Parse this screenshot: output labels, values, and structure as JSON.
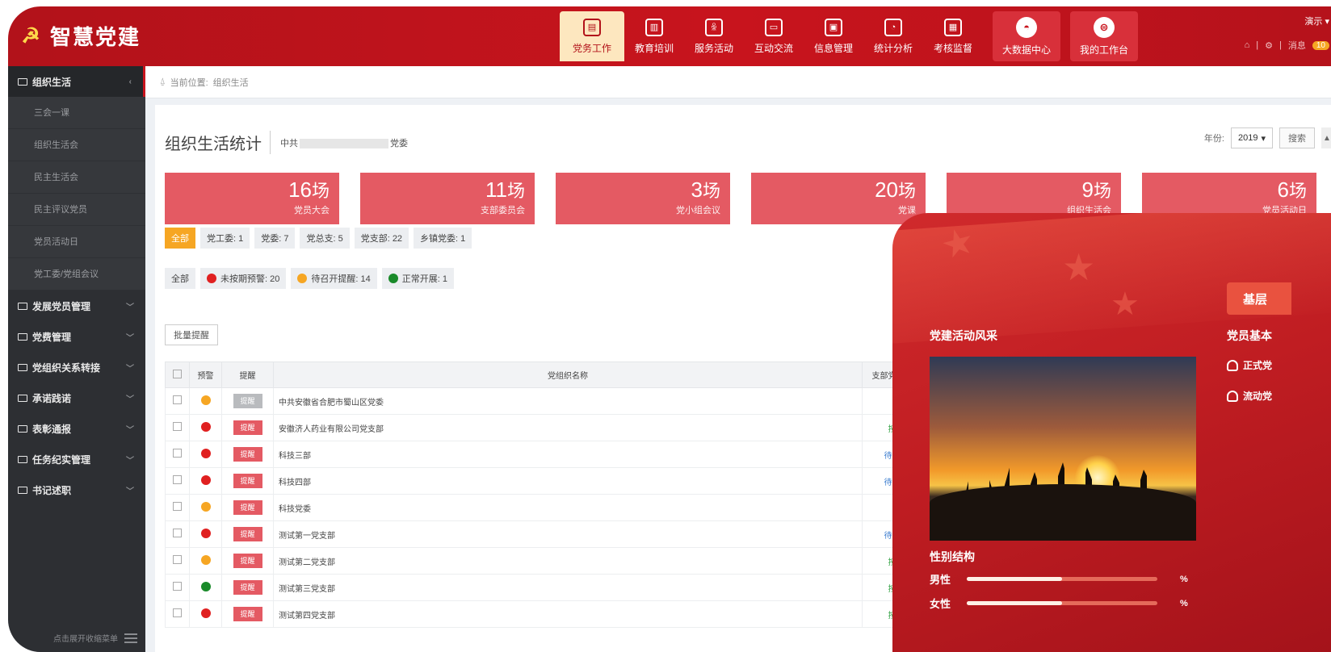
{
  "app": {
    "logo_icon": "☭",
    "title": "智慧党建"
  },
  "nav": {
    "items": [
      {
        "label": "党务工作",
        "icon": "document-icon",
        "glyph": "▤"
      },
      {
        "label": "教育培训",
        "icon": "book-icon",
        "glyph": "▥"
      },
      {
        "label": "服务活动",
        "icon": "people-icon",
        "glyph": "ꆜ"
      },
      {
        "label": "互动交流",
        "icon": "chat-icon",
        "glyph": "▭"
      },
      {
        "label": "信息管理",
        "icon": "folder-icon",
        "glyph": "▣"
      },
      {
        "label": "统计分析",
        "icon": "pie-icon",
        "glyph": "◔"
      },
      {
        "label": "考核监督",
        "icon": "clipboard-icon",
        "glyph": "▦"
      }
    ],
    "big": [
      {
        "label": "大数据中心",
        "glyph": "◓"
      },
      {
        "label": "我的工作台",
        "glyph": "⊜"
      }
    ]
  },
  "topright": {
    "user": "演示",
    "msg_label": "消息",
    "msg_count": "10"
  },
  "sidebar": {
    "active_group": "组织生活",
    "sub_items": [
      "三会一课",
      "组织生活会",
      "民主生活会",
      "民主评议党员",
      "党员活动日",
      "党工委/党组会议"
    ],
    "groups": [
      "发展党员管理",
      "党费管理",
      "党组织关系转接",
      "承诺践诺",
      "表彰通报",
      "任务纪实管理",
      "书记述职"
    ],
    "footer": "点击展开收缩菜单"
  },
  "breadcrumb": {
    "prefix": "当前位置:",
    "current": "组织生活"
  },
  "page": {
    "title": "组织生活统计",
    "org_prefix": "中共",
    "org_suffix": "党委",
    "year_label": "年份:",
    "year_value": "2019",
    "search_label": "搜索"
  },
  "stats": [
    {
      "num": "16",
      "unit": "场",
      "label": "党员大会"
    },
    {
      "num": "11",
      "unit": "场",
      "label": "支部委员会"
    },
    {
      "num": "3",
      "unit": "场",
      "label": "党小组会议"
    },
    {
      "num": "20",
      "unit": "场",
      "label": "党课"
    },
    {
      "num": "9",
      "unit": "场",
      "label": "组织生活会"
    },
    {
      "num": "6",
      "unit": "场",
      "label": "党员活动日"
    }
  ],
  "filter_org": [
    "全部",
    "党工委: 1",
    "党委: 7",
    "党总支: 5",
    "党支部: 22",
    "乡镇党委: 1"
  ],
  "filter_status": [
    {
      "label": "全部",
      "color": ""
    },
    {
      "label": "未按期预警: 20",
      "color": "#e02020"
    },
    {
      "label": "待召开提醒: 14",
      "color": "#f6a623"
    },
    {
      "label": "正常开展: 1",
      "color": "#1a8a2a"
    }
  ],
  "batch_label": "批量提醒",
  "table": {
    "headers": [
      "预警",
      "提醒",
      "党组织名称",
      "支部党员大会"
    ],
    "rows": [
      {
        "warn": "#f6a623",
        "remind": "提醒",
        "remind_gray": true,
        "name": "中共安徽省合肥市蜀山区党委",
        "status": "-",
        "st": ""
      },
      {
        "warn": "#e02020",
        "remind": "提醒",
        "remind_gray": false,
        "name": "安徽济人药业有限公司党支部",
        "status": "按期",
        "st": "st-green"
      },
      {
        "warn": "#e02020",
        "remind": "提醒",
        "remind_gray": false,
        "name": "科技三部",
        "status": "待召开",
        "st": "st-blue"
      },
      {
        "warn": "#e02020",
        "remind": "提醒",
        "remind_gray": false,
        "name": "科技四部",
        "status": "待召开",
        "st": "st-blue"
      },
      {
        "warn": "#f6a623",
        "remind": "提醒",
        "remind_gray": false,
        "name": "科技党委",
        "status": "-",
        "st": ""
      },
      {
        "warn": "#e02020",
        "remind": "提醒",
        "remind_gray": false,
        "name": "测试第一党支部",
        "status": "待召开",
        "st": "st-blue"
      },
      {
        "warn": "#f6a623",
        "remind": "提醒",
        "remind_gray": false,
        "name": "测试第二党支部",
        "status": "按期",
        "st": "st-green"
      },
      {
        "warn": "#1a8a2a",
        "remind": "提醒",
        "remind_gray": false,
        "name": "测试第三党支部",
        "status": "按期",
        "st": "st-green"
      },
      {
        "warn": "#e02020",
        "remind": "提醒",
        "remind_gray": false,
        "name": "测试第四党支部",
        "status": "按期",
        "st": "st-green"
      }
    ]
  },
  "poster": {
    "banner": "基层",
    "activity_title": "党建活动风采",
    "member_title": "党员基本",
    "member_lines": [
      "正式党",
      "流动党"
    ],
    "gender_title": "性别结构",
    "male_label": "男性",
    "female_label": "女性",
    "male_fraction": 0.5,
    "female_fraction": 0.5,
    "pct_sign": "%"
  }
}
